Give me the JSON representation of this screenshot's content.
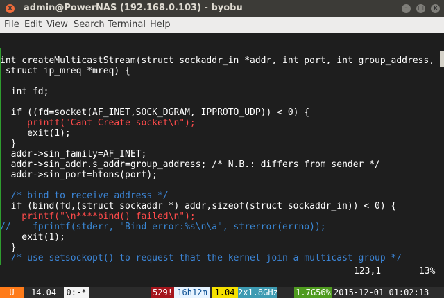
{
  "window": {
    "title": "admin@PowerNAS (192.168.0.103) - byobu",
    "buttons": {
      "min": "–",
      "max": "□",
      "close": "x"
    }
  },
  "menu": [
    "File",
    "Edit",
    "View",
    "Search",
    "Terminal",
    "Help"
  ],
  "code": {
    "lines": [
      "int createMulticastStream(struct sockaddr_in *addr, int port, int group_address,",
      " struct ip_mreq *mreq) {",
      "",
      "  int fd;",
      "",
      "  if ((fd=socket(AF_INET,SOCK_DGRAM, IPPROTO_UDP)) < 0) {",
      "     printf(\"Cant Create socket\\n\");",
      "     exit(1);",
      "  }",
      "  addr->sin_family=AF_INET;",
      "  addr->sin_addr.s_addr=group_address; /* N.B.: differs from sender */",
      "  addr->sin_port=htons(port);",
      "",
      "  /* bind to receive address */",
      "  if (bind(fd,(struct sockaddr *) addr,sizeof(struct sockaddr_in)) < 0) {",
      "    printf(\"\\n****bind() failed\\n\");",
      "//    fprintf(stderr, \"Bind error:%s\\n\\a\", strerror(errno));",
      "    exit(1);",
      "  }",
      "  /* use setsockopt() to request that the kernel join a multicast group */"
    ],
    "position": "123,1",
    "percent": "13%"
  },
  "status": {
    "ubuntu": "U",
    "version": "14.04",
    "session": "0:-*",
    "processes": "529!",
    "uptime": "16h12m",
    "load": "1.04",
    "cpu": "2x1.8GHz",
    "memory": "1.7G56%",
    "datetime": "2015-12-01 01:02:13"
  }
}
